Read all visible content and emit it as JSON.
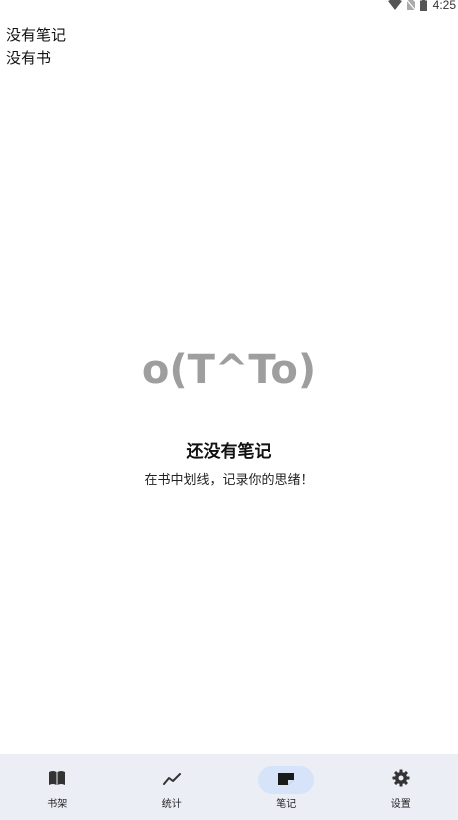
{
  "status_bar": {
    "time": "4:25",
    "icons": [
      "wifi-icon",
      "no-sim-icon",
      "battery-icon"
    ]
  },
  "debug": {
    "line1": "没有笔记",
    "line2": "没有书"
  },
  "empty_state": {
    "kaomoji": "o(T^To)",
    "title": "还没有笔记",
    "subtitle": "在书中划线，记录你的思绪！"
  },
  "bottom_nav": {
    "items": [
      {
        "label": "书架",
        "icon": "book-icon"
      },
      {
        "label": "统计",
        "icon": "trend-icon"
      },
      {
        "label": "笔记",
        "icon": "note-icon",
        "active": true
      },
      {
        "label": "设置",
        "icon": "gear-icon"
      }
    ]
  },
  "colors": {
    "nav_background": "#eceef5",
    "nav_active_pill": "#d7e3f8",
    "kaomoji": "#9e9e9e"
  }
}
